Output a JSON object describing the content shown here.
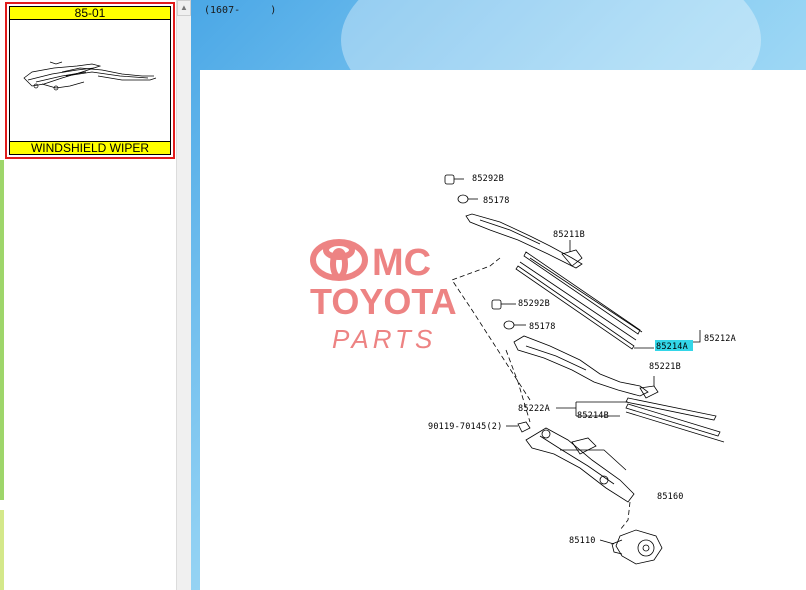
{
  "sidebar": {
    "thumbnail": {
      "code": "85-01",
      "title": "WINDSHIELD WIPER"
    }
  },
  "header": {
    "model_code": "(1607-     )"
  },
  "watermark": {
    "line1": "MC",
    "line2": "TOYOTA",
    "line3": "PARTS"
  },
  "diagram": {
    "parts": [
      {
        "id": "p-85292b-top",
        "label": "85292B"
      },
      {
        "id": "p-85178-top",
        "label": "85178"
      },
      {
        "id": "p-85211b",
        "label": "85211B"
      },
      {
        "id": "p-85292b-mid",
        "label": "85292B"
      },
      {
        "id": "p-85178-mid",
        "label": "85178"
      },
      {
        "id": "p-85214a",
        "label": "85214A",
        "highlighted": true
      },
      {
        "id": "p-85212a",
        "label": "85212A"
      },
      {
        "id": "p-85221b",
        "label": "85221B"
      },
      {
        "id": "p-85222a",
        "label": "85222A"
      },
      {
        "id": "p-85214b",
        "label": "85214B"
      },
      {
        "id": "p-90119",
        "label": "90119-70145(2)"
      },
      {
        "id": "p-85160",
        "label": "85160"
      },
      {
        "id": "p-85110",
        "label": "85110"
      }
    ]
  },
  "colors": {
    "thumb_border": "#e01c1c",
    "thumb_bar": "#ffff00",
    "highlight": "#33d6e8",
    "watermark": "#e85a5a",
    "background": "#6cbcee"
  }
}
